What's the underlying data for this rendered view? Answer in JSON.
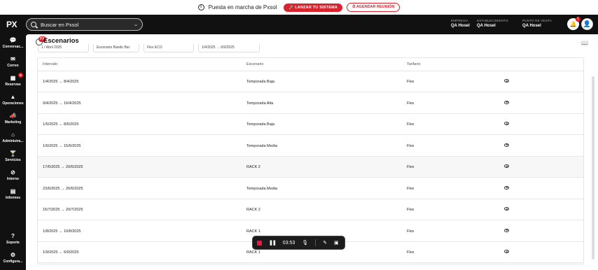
{
  "banner": {
    "info_icon": "i",
    "text": "Puesta en marcha de Pxsol",
    "launch_button": "LANZAR TU SISTEMA",
    "meeting_button": "AGENDAR REUNIÓN"
  },
  "header": {
    "logo": "PX",
    "search_placeholder": "Buscar en Pxsol",
    "company_label": "EMPRESIA",
    "company_value": "QA Hosel",
    "establishment_label": "ESTABLECIMIENTO",
    "establishment_value": "QA Hosel",
    "pos_label": "PUNTO DE VENTA",
    "pos_value": "QA Hosel",
    "notifications_count": "1"
  },
  "sidebar": {
    "items": [
      {
        "label": "Conversac...",
        "icon": "chat-icon"
      },
      {
        "label": "Correo",
        "icon": "mail-icon"
      },
      {
        "label": "Reservas",
        "icon": "calendar-icon",
        "badge": "5"
      },
      {
        "label": "Operaciones",
        "icon": "operations-icon"
      },
      {
        "label": "Marketing",
        "icon": "megaphone-icon"
      },
      {
        "label": "Administra...",
        "icon": "admin-icon"
      },
      {
        "label": "Servicios",
        "icon": "services-icon"
      },
      {
        "label": "Interno",
        "icon": "blocked-icon"
      },
      {
        "label": "Informes",
        "icon": "report-icon"
      },
      {
        "label": "Soporte",
        "icon": "help-icon"
      },
      {
        "label": "Configura...",
        "icon": "gear-icon"
      }
    ]
  },
  "page": {
    "title": "Escenarios",
    "title_badge": "PX",
    "filters": [
      "1 / Abril 2025",
      "Escenario Bando Bar",
      "Flex ECO",
      "1/4/2025 → 6/9/2025"
    ]
  },
  "table": {
    "headers": [
      "Intervalo",
      "Escenario",
      "Tarifario"
    ],
    "rows": [
      {
        "from": "1/4/2025",
        "to": "8/4/2025",
        "scenario": "Temporada Baja",
        "rate": "Flex"
      },
      {
        "from": "9/4/2025",
        "to": "16/4/2025",
        "scenario": "Temporada Alta",
        "rate": "Flex"
      },
      {
        "from": "1/5/2025",
        "to": "8/5/2025",
        "scenario": "Temporada Baja",
        "rate": "Flex"
      },
      {
        "from": "1/6/2025",
        "to": "15/6/2025",
        "scenario": "Temporada Media",
        "rate": "Flex"
      },
      {
        "from": "17/6/2025",
        "to": "20/6/2025",
        "scenario": "RACK 2",
        "rate": "Flex"
      },
      {
        "from": "23/6/2025",
        "to": "26/6/2025",
        "scenario": "Temporada Media",
        "rate": "Flex"
      },
      {
        "from": "15/7/2025",
        "to": "20/7/2025",
        "scenario": "RACK 2",
        "rate": "Flex"
      },
      {
        "from": "1/8/2025",
        "to": "10/8/2025",
        "scenario": "RACK 1",
        "rate": "Flex"
      },
      {
        "from": "1/9/2025",
        "to": "6/9/2025",
        "scenario": "RACK 1",
        "rate": "Flex"
      }
    ]
  },
  "recorder": {
    "time": "03:53"
  }
}
